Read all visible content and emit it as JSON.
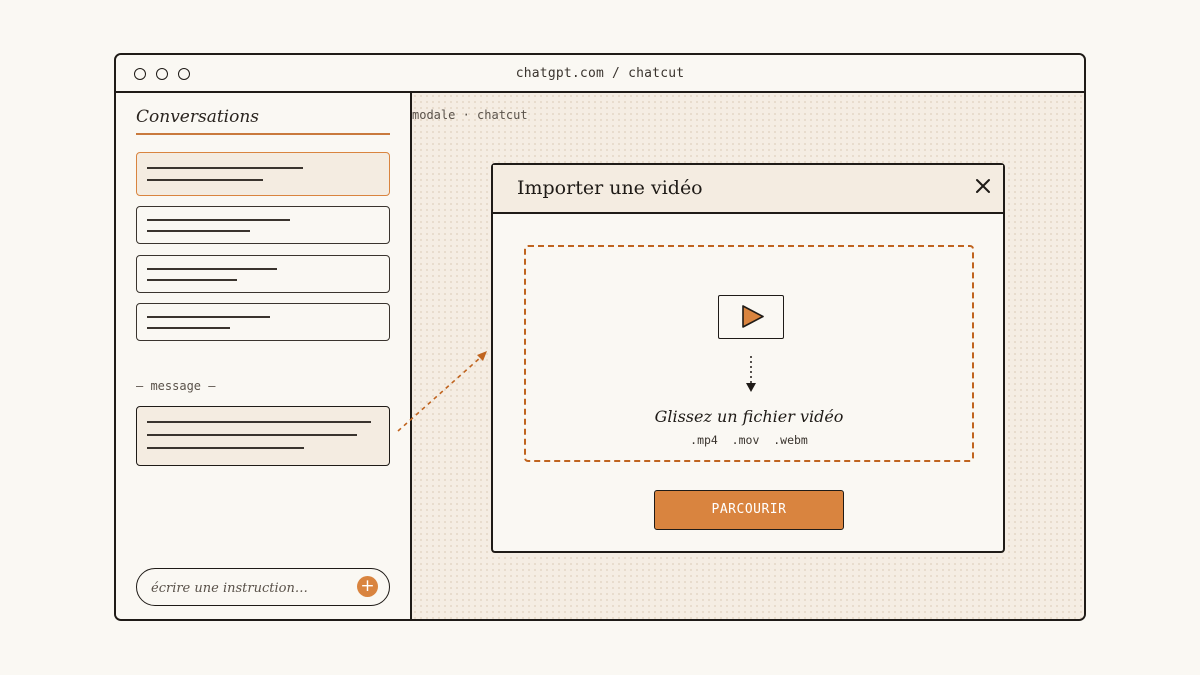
{
  "browser": {
    "url": "chatgpt.com / chatcut",
    "window_controls": [
      "circle-icon",
      "circle-icon",
      "circle-icon"
    ]
  },
  "sidebar": {
    "title": "Conversations",
    "message_label": "— message —",
    "input_placeholder": "écrire une instruction…",
    "send_icon": "plus-icon"
  },
  "canvas": {
    "label": "modale · chatcut"
  },
  "modal": {
    "title": "Importer une vidéo",
    "close_icon": "close-icon",
    "drop_icon": "video-play-icon",
    "drop_title": "Glissez un fichier vidéo",
    "drop_formats": ".mp4  .mov  .webm",
    "browse_label": "PARCOURIR"
  },
  "colors": {
    "accent": "#d9843f",
    "accent_dark": "#c0641f",
    "ink": "#1f1b17",
    "paper": "#faf8f3",
    "panel": "#f4ece1"
  }
}
